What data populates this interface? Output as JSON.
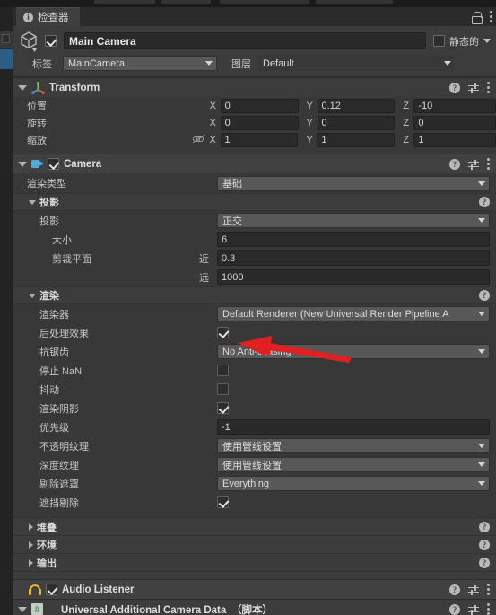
{
  "window": {
    "tab_title": "检查器",
    "info_icon": "info-icon",
    "lock_icon": "lock-icon",
    "menu_icon": "kebab-menu-icon"
  },
  "object_header": {
    "name": "Main Camera",
    "enabled": true,
    "static_label": "静态的",
    "tag_label": "标签",
    "tag_value": "MainCamera",
    "layer_label": "图层",
    "layer_value": "Default"
  },
  "components": [
    {
      "title": "Transform",
      "expanded": true,
      "rows": [
        {
          "label": "位置",
          "x": "0",
          "y": "0.12",
          "z": "-10"
        },
        {
          "label": "旋转",
          "x": "0",
          "y": "0",
          "z": "0"
        },
        {
          "label": "缩放",
          "x": "1",
          "y": "1",
          "z": "1"
        }
      ],
      "axis_labels": {
        "x": "X",
        "y": "Y",
        "z": "Z"
      }
    },
    {
      "title": "Camera",
      "enabled": true,
      "expanded": true,
      "render_type": {
        "label": "渲染类型",
        "value": "基础"
      },
      "projection_section": {
        "title": "投影",
        "projection": {
          "label": "投影",
          "value": "正交"
        },
        "size": {
          "label": "大小",
          "value": "6"
        },
        "clipping": {
          "label": "剪裁平面",
          "near_label": "近",
          "near_value": "0.3",
          "far_label": "远",
          "far_value": "1000"
        }
      },
      "render_section": {
        "title": "渲染",
        "renderer": {
          "label": "渲染器",
          "value": "Default Renderer (New Universal Render Pipeline A"
        },
        "post_processing": {
          "label": "后处理效果",
          "checked": true
        },
        "anti_aliasing": {
          "label": "抗锯齿",
          "value": "No Anti-aliasing"
        },
        "stop_nan": {
          "label": "停止 NaN",
          "checked": false
        },
        "dithering": {
          "label": "抖动",
          "checked": false
        },
        "render_shadows": {
          "label": "渲染阴影",
          "checked": true
        },
        "priority": {
          "label": "优先级",
          "value": "-1"
        },
        "opaque_texture": {
          "label": "不透明纹理",
          "value": "使用管线设置"
        },
        "depth_texture": {
          "label": "深度纹理",
          "value": "使用管线设置"
        },
        "culling_mask": {
          "label": "剔除遮罩",
          "value": "Everything"
        },
        "occlusion_culling": {
          "label": "遮挡剔除",
          "checked": true
        }
      },
      "collapsed_sections": [
        {
          "title": "堆叠"
        },
        {
          "title": "环境"
        },
        {
          "title": "输出"
        }
      ]
    },
    {
      "title": "Audio Listener",
      "enabled": true,
      "expanded": false
    },
    {
      "title": "Universal Additional Camera Data　（脚本）",
      "expanded": true
    }
  ],
  "annotation": {
    "arrow_color": "#e02121",
    "points_at": "post-processing-checkbox"
  },
  "colors": {
    "panel_bg": "#383838",
    "header_bg": "#414141",
    "field_bg": "#2a2a2a",
    "dropdown_bg": "#585858",
    "accent_blue": "#4ea8dd",
    "accent_yellow": "#e8b92c",
    "accent_green": "#3aa34a"
  }
}
